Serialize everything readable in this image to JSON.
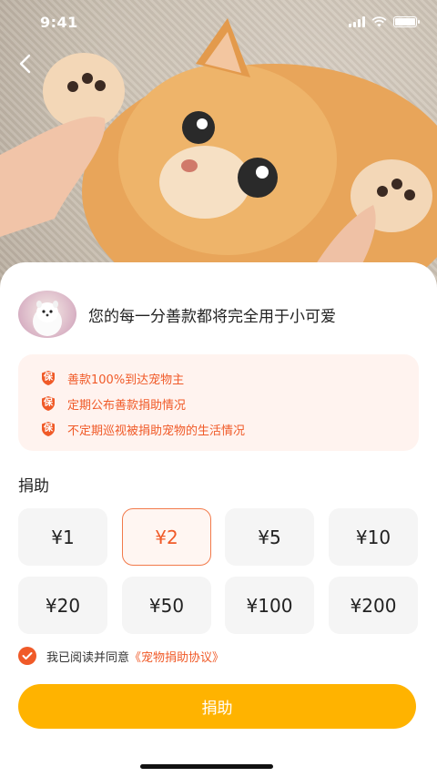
{
  "status_bar": {
    "time": "9:41"
  },
  "nav": {
    "back_icon": "chevron-left-icon"
  },
  "intro": {
    "text": "您的每一分善款都将完全用于小可爱"
  },
  "promises": [
    {
      "badge": "保",
      "text": "善款100%到达宠物主"
    },
    {
      "badge": "保",
      "text": "定期公布善款捐助情况"
    },
    {
      "badge": "保",
      "text": "不定期巡视被捐助宠物的生活情况"
    }
  ],
  "donate": {
    "title": "捐助",
    "amounts": [
      "¥1",
      "¥2",
      "¥5",
      "¥10",
      "¥20",
      "¥50",
      "¥100",
      "¥200"
    ],
    "selected_index": 1
  },
  "agreement": {
    "checked": true,
    "prefix": "我已阅读并同意",
    "link": "《宠物捐助协议》"
  },
  "button": {
    "label": "捐助"
  },
  "colors": {
    "accent": "#f05a28",
    "button": "#ffb300",
    "promise_bg": "#fff3ef",
    "chip_bg": "#f5f5f5"
  }
}
